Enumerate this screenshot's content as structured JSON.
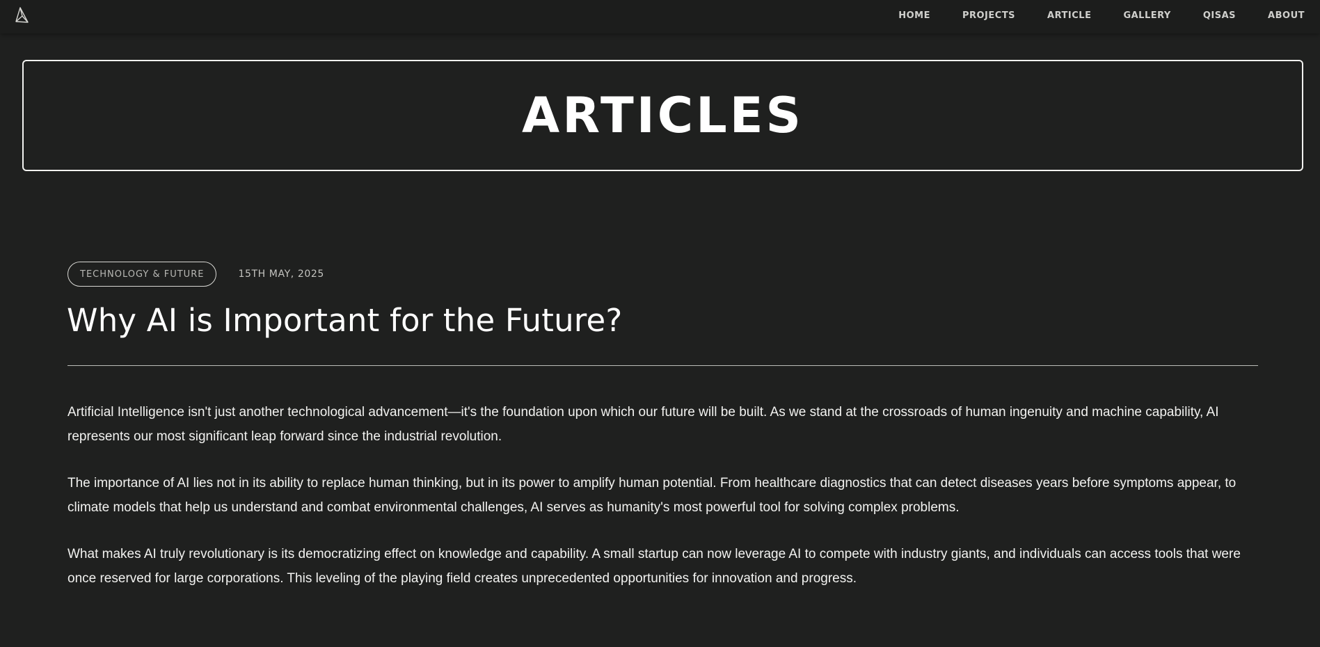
{
  "nav": {
    "items": [
      "HOME",
      "PROJECTS",
      "ARTICLE",
      "GALLERY",
      "QISAS",
      "ABOUT"
    ]
  },
  "hero": {
    "title": "ARTICLES"
  },
  "article": {
    "category": "TECHNOLOGY & FUTURE",
    "date": "15TH MAY, 2025",
    "title": "Why AI is Important for the Future?",
    "paragraphs": [
      "Artificial Intelligence isn't just another technological advancement—it's the foundation upon which our future will be built. As we stand at the crossroads of human ingenuity and machine capability, AI represents our most significant leap forward since the industrial revolution.",
      "The importance of AI lies not in its ability to replace human thinking, but in its power to amplify human potential. From healthcare diagnostics that can detect diseases years before symptoms appear, to climate models that help us understand and combat environmental challenges, AI serves as humanity's most powerful tool for solving complex problems.",
      "What makes AI truly revolutionary is its democratizing effect on knowledge and capability. A small startup can now leverage AI to compete with industry giants, and individuals can access tools that were once reserved for large corporations. This leveling of the playing field creates unprecedented opportunities for innovation and progress."
    ]
  },
  "colors": {
    "background": "#1f201f",
    "text": "#f2f2f0",
    "muted": "#b8b8b4"
  },
  "icons": {
    "logo": "triangle-logo-icon"
  }
}
